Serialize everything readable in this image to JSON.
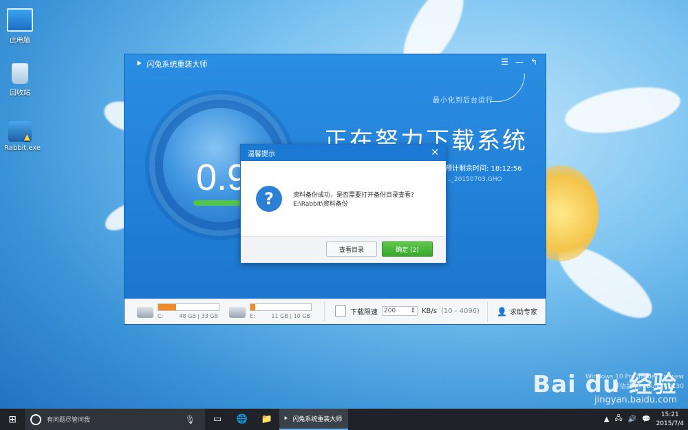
{
  "desktop": {
    "icons": [
      {
        "label": "此电脑"
      },
      {
        "label": "回收站"
      },
      {
        "label": "Rabbit.exe"
      }
    ],
    "watermark": {
      "logo": "Bai du 经验",
      "url": "jingyan.baidu.com"
    },
    "build_lines": [
      "Windows 10 Pro Insider Preview",
      "评估副本。 Build 10130"
    ]
  },
  "app": {
    "title": "闪兔系统重装大师",
    "titlebar_icons": [
      "menu-icon",
      "minimize-icon",
      "restore-icon"
    ],
    "hint": "最小化到后台运行",
    "progress_text": "0.9",
    "status": "正在努力下载系统",
    "remaining_label": "预计剩余时间: 18:12:56",
    "filename": "..._20150703.GHO",
    "bottom": {
      "drive_c": {
        "letter": "C:",
        "usage": "48 GB | 33 GB",
        "fill": 0.3
      },
      "drive_e": {
        "letter": "E:",
        "usage": "11 GB | 10 GB",
        "fill": 0.08
      },
      "limit_label": "下载限速",
      "limit_value": "200",
      "unit": "KB/s",
      "range": "(10 - 4096)",
      "expert_label": "求助专家"
    }
  },
  "dialog": {
    "title": "温馨提示",
    "message_line1": "资料备份成功，是否需要打开备份目录查看?",
    "message_line2": "E:\\Rabbit\\资料备份",
    "btn_view": "查看目录",
    "btn_ok": "确定 (2)"
  },
  "taskbar": {
    "search_placeholder": "有问题尽管问我",
    "app_label": "闪兔系统重装大师",
    "time": "15:21",
    "date": "2015/7/4"
  }
}
